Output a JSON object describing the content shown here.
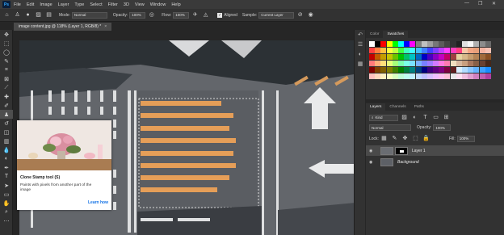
{
  "app": {
    "logo": "Ps"
  },
  "menu": [
    "File",
    "Edit",
    "Image",
    "Layer",
    "Type",
    "Select",
    "Filter",
    "3D",
    "View",
    "Window",
    "Help"
  ],
  "window_controls": {
    "minimize": "—",
    "restore": "❐",
    "close": "✕"
  },
  "options": {
    "mode_label": "Mode:",
    "mode_value": "Normal",
    "opacity_label": "Opacity:",
    "opacity_value": "100%",
    "flow_label": "Flow:",
    "flow_value": "100%",
    "aligned_label": "Aligned",
    "sample_label": "Sample:",
    "sample_value": "Current Layer"
  },
  "document": {
    "tab_title": "image content.jpg @ 118% (Layer 1, RGB/8) *",
    "close": "×"
  },
  "tooltip": {
    "title": "Clone Stamp tool (S)",
    "description": "Paints with pixels from another part of the image",
    "link": "Learn how"
  },
  "color_panel": {
    "tabs": [
      "Color",
      "Swatches"
    ],
    "active_tab": "Swatches",
    "swatch_rows": [
      [
        "#ffffff",
        "#000000",
        "#ff0000",
        "#ffff00",
        "#00ff00",
        "#00ffff",
        "#0000ff",
        "#ff00ff",
        "#808080",
        "#c0c0c0",
        "#9e9e9e",
        "#777777",
        "#5c5c5c",
        "#454545",
        "#333333",
        "#222222",
        "#e0e0e0",
        "#f7f7f7",
        "#b0b0b0",
        "#8c8c8c",
        "#6a6a6a"
      ],
      [
        "#ff4040",
        "#ff8040",
        "#ffbf40",
        "#ffff40",
        "#bfff40",
        "#40ff40",
        "#40ffbf",
        "#40ffff",
        "#40bfff",
        "#4080ff",
        "#4040ff",
        "#8040ff",
        "#bf40ff",
        "#ff40ff",
        "#ff40bf",
        "#ff4080",
        "#f7c6a6",
        "#f3a683",
        "#e8a07a",
        "#f4b3a0",
        "#f6c1b3"
      ],
      [
        "#c40000",
        "#c45a00",
        "#c49e00",
        "#c4c400",
        "#6ac400",
        "#00c400",
        "#00c46a",
        "#00c4c4",
        "#006ac4",
        "#0000c4",
        "#4a00c4",
        "#8a00c4",
        "#c400c4",
        "#c4006a",
        "#a04040",
        "#e6d3a0",
        "#d8b88a",
        "#c69e70",
        "#b48456",
        "#a06a3c",
        "#8a5024"
      ],
      [
        "#ff7a7a",
        "#ffb07a",
        "#ffe07a",
        "#e8ff7a",
        "#a6ff7a",
        "#7affb0",
        "#7affe8",
        "#7ae0ff",
        "#7ab0ff",
        "#7a80ff",
        "#a07aff",
        "#d27aff",
        "#ff7ae0",
        "#ff7ab0",
        "#f0e0c0",
        "#d7b9a0",
        "#c8a080",
        "#a87860",
        "#886048",
        "#684030",
        "#482818"
      ],
      [
        "#800000",
        "#804000",
        "#806000",
        "#808000",
        "#408000",
        "#008000",
        "#008040",
        "#008080",
        "#004080",
        "#000080",
        "#400080",
        "#600080",
        "#800080",
        "#800040",
        "#602020",
        "#d9f0ff",
        "#b3dcff",
        "#8cc8ff",
        "#66b4ff",
        "#40a0ff",
        "#1a8cff"
      ],
      [
        "#ffc0c0",
        "#ffd8c0",
        "#fff0c0",
        "#f8ffc0",
        "#d8ffc0",
        "#c0ffd8",
        "#c0fff0",
        "#c0f0ff",
        "#c0d8ff",
        "#c0c0ff",
        "#d8c0ff",
        "#f0c0ff",
        "#ffc0f0",
        "#ffc0d8",
        "#e8e8e8",
        "#ffe0f0",
        "#f0c0e0",
        "#e0a0d0",
        "#d080c0",
        "#c060b0",
        "#b040a0"
      ]
    ]
  },
  "layers_panel": {
    "tabs": [
      "Layers",
      "Channels",
      "Paths"
    ],
    "active_tab": "Layers",
    "kind_label": "Kind",
    "blend_mode": "Normal",
    "opacity_label": "Opacity:",
    "opacity_value": "100%",
    "lock_label": "Lock:",
    "fill_label": "Fill:",
    "fill_value": "100%",
    "layers": [
      {
        "name": "Layer 1",
        "italic": false,
        "selected": true
      },
      {
        "name": "Background",
        "italic": true,
        "selected": false
      }
    ]
  }
}
